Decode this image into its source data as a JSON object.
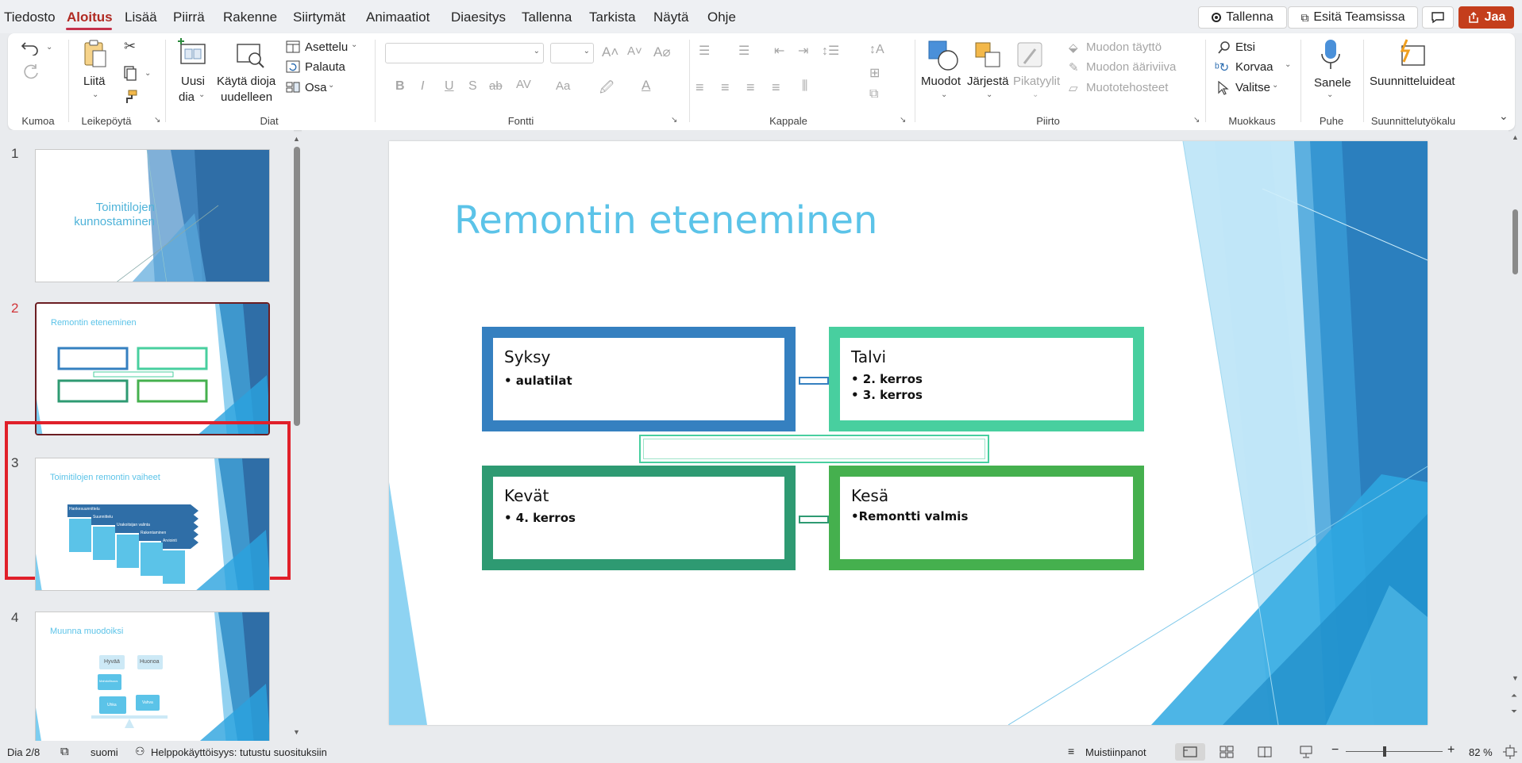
{
  "menu": {
    "tabs": [
      "Tiedosto",
      "Aloitus",
      "Lisää",
      "Piirrä",
      "Rakenne",
      "Siirtymät",
      "Animaatiot",
      "Diaesitys",
      "Tallenna",
      "Tarkista",
      "Näytä",
      "Ohje"
    ],
    "record": "Tallenna",
    "teams": "Esitä Teamsissa",
    "share": "Jaa"
  },
  "ribbon": {
    "groups": {
      "undo": "Kumoa",
      "clipboard": "Leikepöytä",
      "slides": "Diat",
      "font": "Fontti",
      "paragraph": "Kappale",
      "drawing": "Piirto",
      "editing": "Muokkaus",
      "voice": "Puhe",
      "designer": "Suunnittelutyökalu"
    },
    "paste": "Liitä",
    "new_slide_1": "Uusi",
    "new_slide_2": "dia",
    "reuse_1": "Käytä dioja",
    "reuse_2": "uudelleen",
    "layout": "Asettelu",
    "reset": "Palauta",
    "section": "Osa",
    "shapes": "Muodot",
    "arrange": "Järjestä",
    "quick_styles": "Pikatyylit",
    "shape_fill": "Muodon täyttö",
    "shape_outline": "Muodon ääriviiva",
    "shape_effects": "Muototehosteet",
    "find": "Etsi",
    "replace": "Korvaa",
    "select": "Valitse",
    "dictate": "Sanele",
    "designer": "Suunnitteluideat",
    "font_buttons": [
      "B",
      "I",
      "U",
      "S",
      "ab",
      "AV",
      "Aa"
    ]
  },
  "thumbnails": [
    {
      "num": "1",
      "title": "Toimitilojen kunnostaminen"
    },
    {
      "num": "2",
      "title": "Remontin eteneminen"
    },
    {
      "num": "3",
      "title": "Toimitilojen remontin vaiheet"
    },
    {
      "num": "4",
      "title": "Muunna muodoiksi"
    }
  ],
  "thumb3_steps": [
    "Hankesuunnittelu",
    "Suunnittelu",
    "Urakoitsijan valinta",
    "Rakentaminen",
    "Arviointi"
  ],
  "thumb4_labels": [
    "Hyvää",
    "Huonoa",
    "Mahdollisuus",
    "Uhka",
    "Vahva"
  ],
  "slide": {
    "title": "Remontin eteneminen",
    "boxes": [
      {
        "title": "Syksy",
        "bullets": [
          "• aulatilat"
        ]
      },
      {
        "title": "Talvi",
        "bullets": [
          "• 2. kerros",
          "• 3. kerros"
        ]
      },
      {
        "title": "Kevät",
        "bullets": [
          "• 4. kerros"
        ]
      },
      {
        "title": "Kesä",
        "bullets": [
          "•Remontti valmis"
        ]
      }
    ],
    "colors": {
      "blue": "#3580c0",
      "teal": "#48cf9f",
      "green_dark": "#2e9a72",
      "green": "#45b04e",
      "title": "#5bc3e8"
    }
  },
  "status": {
    "slide": "Dia 2/8",
    "language": "suomi",
    "accessibility": "Helppokäyttöisyys: tutustu suosituksiin",
    "notes": "Muistiinpanot",
    "zoom": "82 %"
  }
}
